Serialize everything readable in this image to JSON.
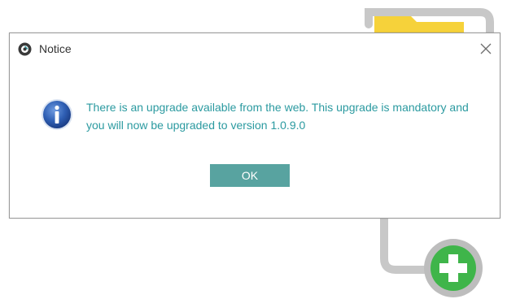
{
  "dialog": {
    "title": "Notice",
    "message": "There is an upgrade available from the web. This upgrade is mandatory and you will now be upgraded to version 1.0.9.0",
    "ok_label": "OK",
    "close_glyph": "✕"
  },
  "icons": {
    "app": "app-logo-icon",
    "message": "info-icon",
    "close": "close-icon",
    "background_folder": "folder-icon",
    "background_add": "add-plus-icon"
  },
  "colors": {
    "message_text": "#2b9aa0",
    "ok_button": "#58a3a0",
    "add_badge": "#3fb54a",
    "folder": "#f6d23a",
    "connector": "#c8c8c8"
  }
}
